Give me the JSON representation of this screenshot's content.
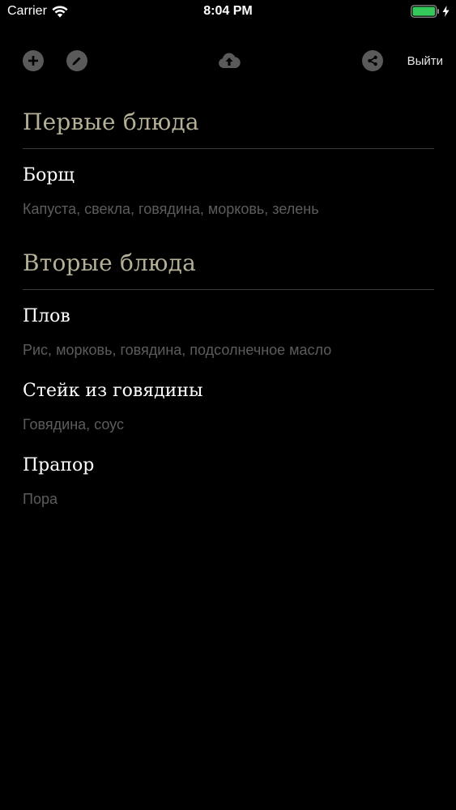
{
  "status_bar": {
    "carrier": "Carrier",
    "time": "8:04 PM",
    "battery_color": "#34c759"
  },
  "toolbar": {
    "add_icon": "plus-icon",
    "edit_icon": "pencil-icon",
    "upload_icon": "cloud-upload-icon",
    "share_icon": "share-icon",
    "logout_label": "Выйти"
  },
  "sections": [
    {
      "title": "Первые блюда",
      "items": [
        {
          "name": "Борщ",
          "ingredients": "Капуста, свекла, говядина, морковь, зелень"
        }
      ]
    },
    {
      "title": "Вторые блюда",
      "items": [
        {
          "name": "Плов",
          "ingredients": "Рис, морковь, говядина, подсолнечное масло"
        },
        {
          "name": "Стейк из говядины",
          "ingredients": "Говядина, соус"
        },
        {
          "name": "Прапор",
          "ingredients": "Пора"
        }
      ]
    }
  ],
  "colors": {
    "background": "#000000",
    "section_title": "#b5b097",
    "item_title": "#ffffff",
    "item_subtitle": "#5c5c5c",
    "divider": "#3b3b3b",
    "icon_bg": "#5a5a5a"
  }
}
